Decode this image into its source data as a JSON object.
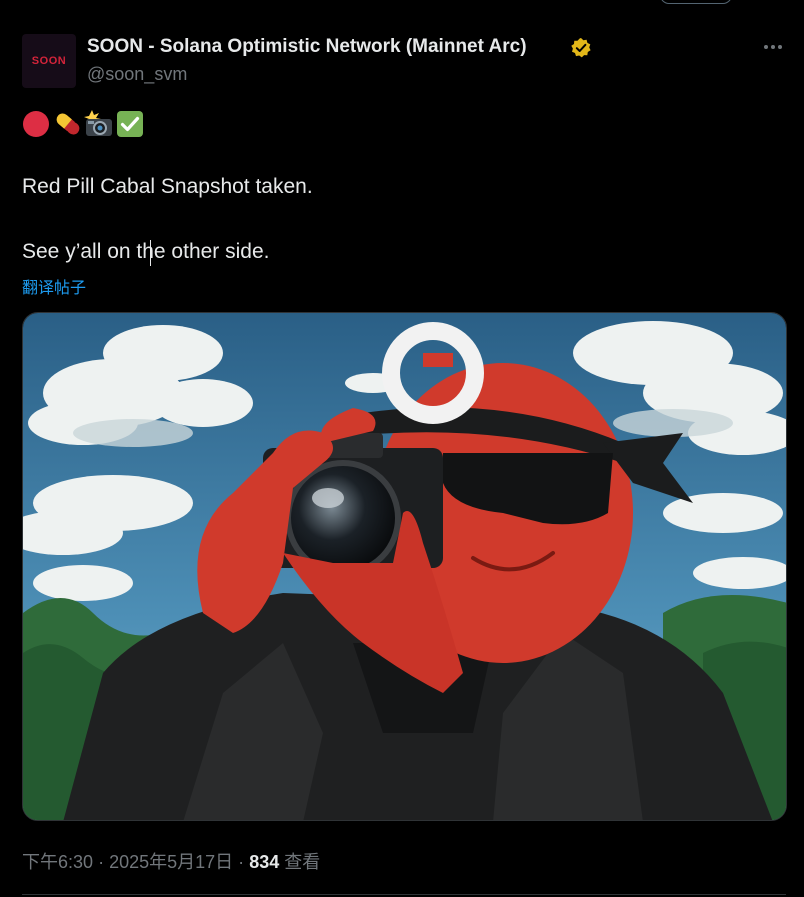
{
  "author": {
    "avatar_text": "SOON",
    "display_name": "SOON - Solana Optimistic Network (Mainnet Arc)",
    "handle": "@soon_svm"
  },
  "post": {
    "emoji": [
      "🔴",
      "💊",
      "📸",
      "✅"
    ],
    "line1": "Red Pill Cabal Snapshot taken.",
    "line2": "See y’all on the other side.",
    "translate_label": "翻译帖子"
  },
  "meta": {
    "time": "下午6:30",
    "separator": "·",
    "date": "2025年5月17日",
    "views_count": "834",
    "views_label": "查看"
  },
  "colors": {
    "background": "#000000",
    "text": "#e7e9ea",
    "secondary": "#71767b",
    "link": "#1d9bf0",
    "verified": "#e2b719",
    "divider": "#2f3336"
  }
}
